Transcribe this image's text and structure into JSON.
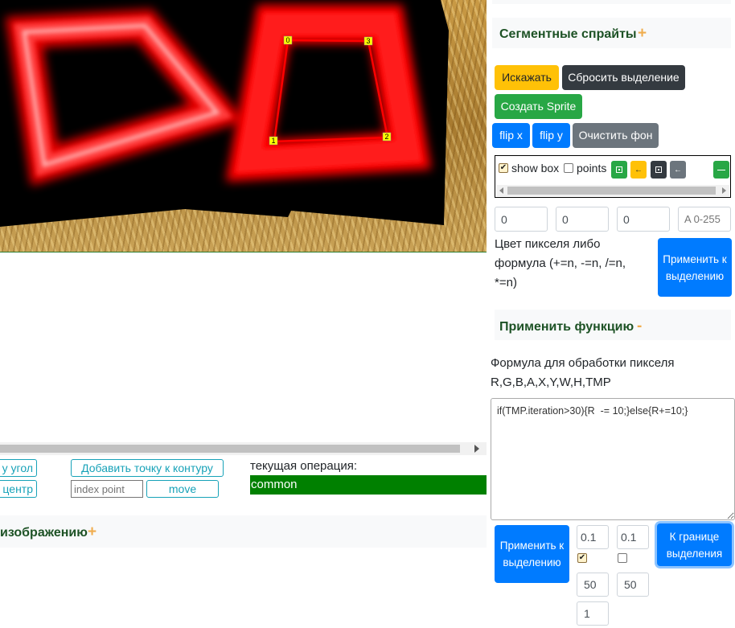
{
  "canvas": {
    "points": [
      "0",
      "1",
      "2",
      "3"
    ]
  },
  "bottom_left": {
    "corner_button_partial": "у угол",
    "center_button_partial": "центр",
    "add_point_button": "Добавить точку к контуру",
    "index_point_placeholder": "index point",
    "move_button": "move",
    "current_operation_label": "текущая операция:",
    "current_operation_value": "common",
    "image_section_title_partial": "изображению",
    "image_section_toggle": "+"
  },
  "right_panel": {
    "segment_sprites": {
      "title": "Сегментные спрайты",
      "toggle": "+"
    },
    "buttons": {
      "distort": "Искажать",
      "reset_selection": "Сбросить выделение",
      "create_sprite": "Создать Sprite",
      "flip_x": "flip x",
      "flip_y": "flip y",
      "clear_bg": "Очистить фон"
    },
    "toolbar": {
      "show_box_label": "show box",
      "show_box_checked": true,
      "points_label": "points",
      "points_checked": false,
      "icons": [
        "dot-green-icon",
        "arrow-left-yellow-icon",
        "dot-dark-icon",
        "arrow-left-gray-icon",
        "minus-green-icon"
      ]
    },
    "pixel_inputs": {
      "r": "0",
      "g": "0",
      "b": "0",
      "a_placeholder": "A 0-255"
    },
    "pixel_color_label": "Цвет пикселя либо формула (+=n, -=n, /=n, *=n)",
    "apply_to_selection": "Применить к выделению",
    "apply_function": {
      "title": "Применить функцию",
      "toggle": "-"
    },
    "formula_label": "Формула для обработки пикселя R,G,B,A,X,Y,W,H,TMP",
    "formula_value": "if(TMP.iteration>30){R  -= 10;}else{R+=10;}",
    "apply_function_button": "Применить к выделению",
    "params": {
      "a1": "0.1",
      "a2": "0.1",
      "check1": true,
      "check2": false,
      "b1": "50",
      "b2": "50",
      "c1": "1"
    },
    "to_selection_border": "К границе выделения"
  },
  "colors": {
    "accent_green": "#1d5225",
    "operation_bg": "#008000",
    "warning": "#ffc107",
    "primary": "#007bff",
    "success": "#28a745",
    "dark": "#343a40",
    "secondary": "#6c757d"
  }
}
